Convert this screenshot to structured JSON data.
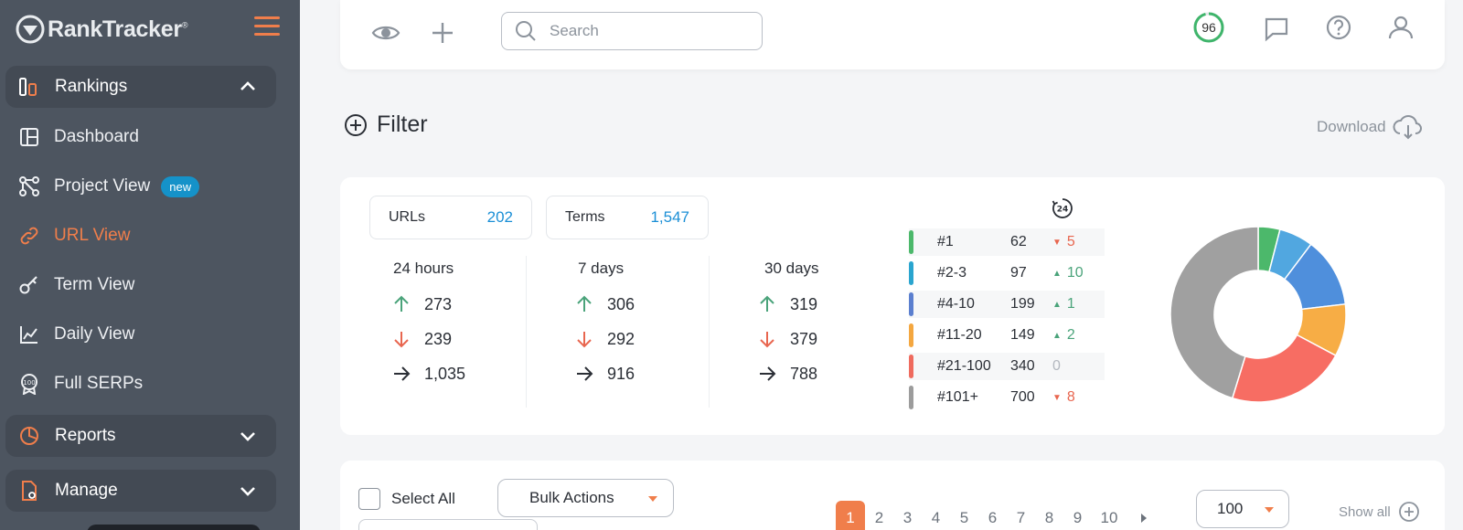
{
  "sidebar": {
    "logo_prefix": "PRO",
    "logo_text": "RankTracker",
    "logo_reg": "®",
    "groups": [
      {
        "label": "Rankings",
        "icon": "rankings-icon",
        "expanded": true
      },
      {
        "label": "Reports",
        "icon": "reports-icon",
        "expanded": false
      },
      {
        "label": "Manage",
        "icon": "manage-icon",
        "expanded": false
      }
    ],
    "items": [
      {
        "label": "Dashboard",
        "icon": "dashboard-icon"
      },
      {
        "label": "Project View",
        "icon": "project-view-icon",
        "badge": "new"
      },
      {
        "label": "URL View",
        "icon": "link-icon",
        "active": true
      },
      {
        "label": "Term View",
        "icon": "key-icon"
      },
      {
        "label": "Daily View",
        "icon": "line-chart-icon"
      },
      {
        "label": "Full SERPs",
        "icon": "serps-badge-icon",
        "icon_text": "100"
      }
    ],
    "accent_color": "#f07e4b"
  },
  "topbar": {
    "search_placeholder": "Search",
    "score": "96"
  },
  "filter": {
    "title": "Filter",
    "download_label": "Download"
  },
  "counts": {
    "urls_label": "URLs",
    "urls_value": "202",
    "terms_label": "Terms",
    "terms_value": "1,547"
  },
  "periods": [
    {
      "label": "24 hours",
      "up": "273",
      "down": "239",
      "same": "1,035"
    },
    {
      "label": "7 days",
      "up": "306",
      "down": "292",
      "same": "916"
    },
    {
      "label": "30 days",
      "up": "319",
      "down": "379",
      "same": "788"
    }
  ],
  "clock_label": "24",
  "ranks": [
    {
      "label": "#1",
      "value": "62",
      "delta": "5",
      "dir": "down",
      "color": "#4cb86b"
    },
    {
      "label": "#2-3",
      "value": "97",
      "delta": "10",
      "dir": "up",
      "color": "#2aa5cf"
    },
    {
      "label": "#4-10",
      "value": "199",
      "delta": "1",
      "dir": "up",
      "color": "#5b7fcf"
    },
    {
      "label": "#11-20",
      "value": "149",
      "delta": "2",
      "dir": "up",
      "color": "#f4a740"
    },
    {
      "label": "#21-100",
      "value": "340",
      "delta": "0",
      "dir": "flat",
      "color": "#ef6b5e"
    },
    {
      "label": "#101+",
      "value": "700",
      "delta": "8",
      "dir": "down",
      "color": "#9c9c9c"
    }
  ],
  "donut_colors": [
    "#4cb86b",
    "#51a7e0",
    "#4f8fdc",
    "#f7ad45",
    "#f76d63",
    "#a0a0a0"
  ],
  "bulk": {
    "select_all": "Select All",
    "bulk_actions": "Bulk Actions"
  },
  "pagination": {
    "pages": [
      "1",
      "2",
      "3",
      "4",
      "5",
      "6",
      "7",
      "8",
      "9",
      "10"
    ],
    "current": "1",
    "per_page": "100",
    "show_all": "Show all"
  }
}
